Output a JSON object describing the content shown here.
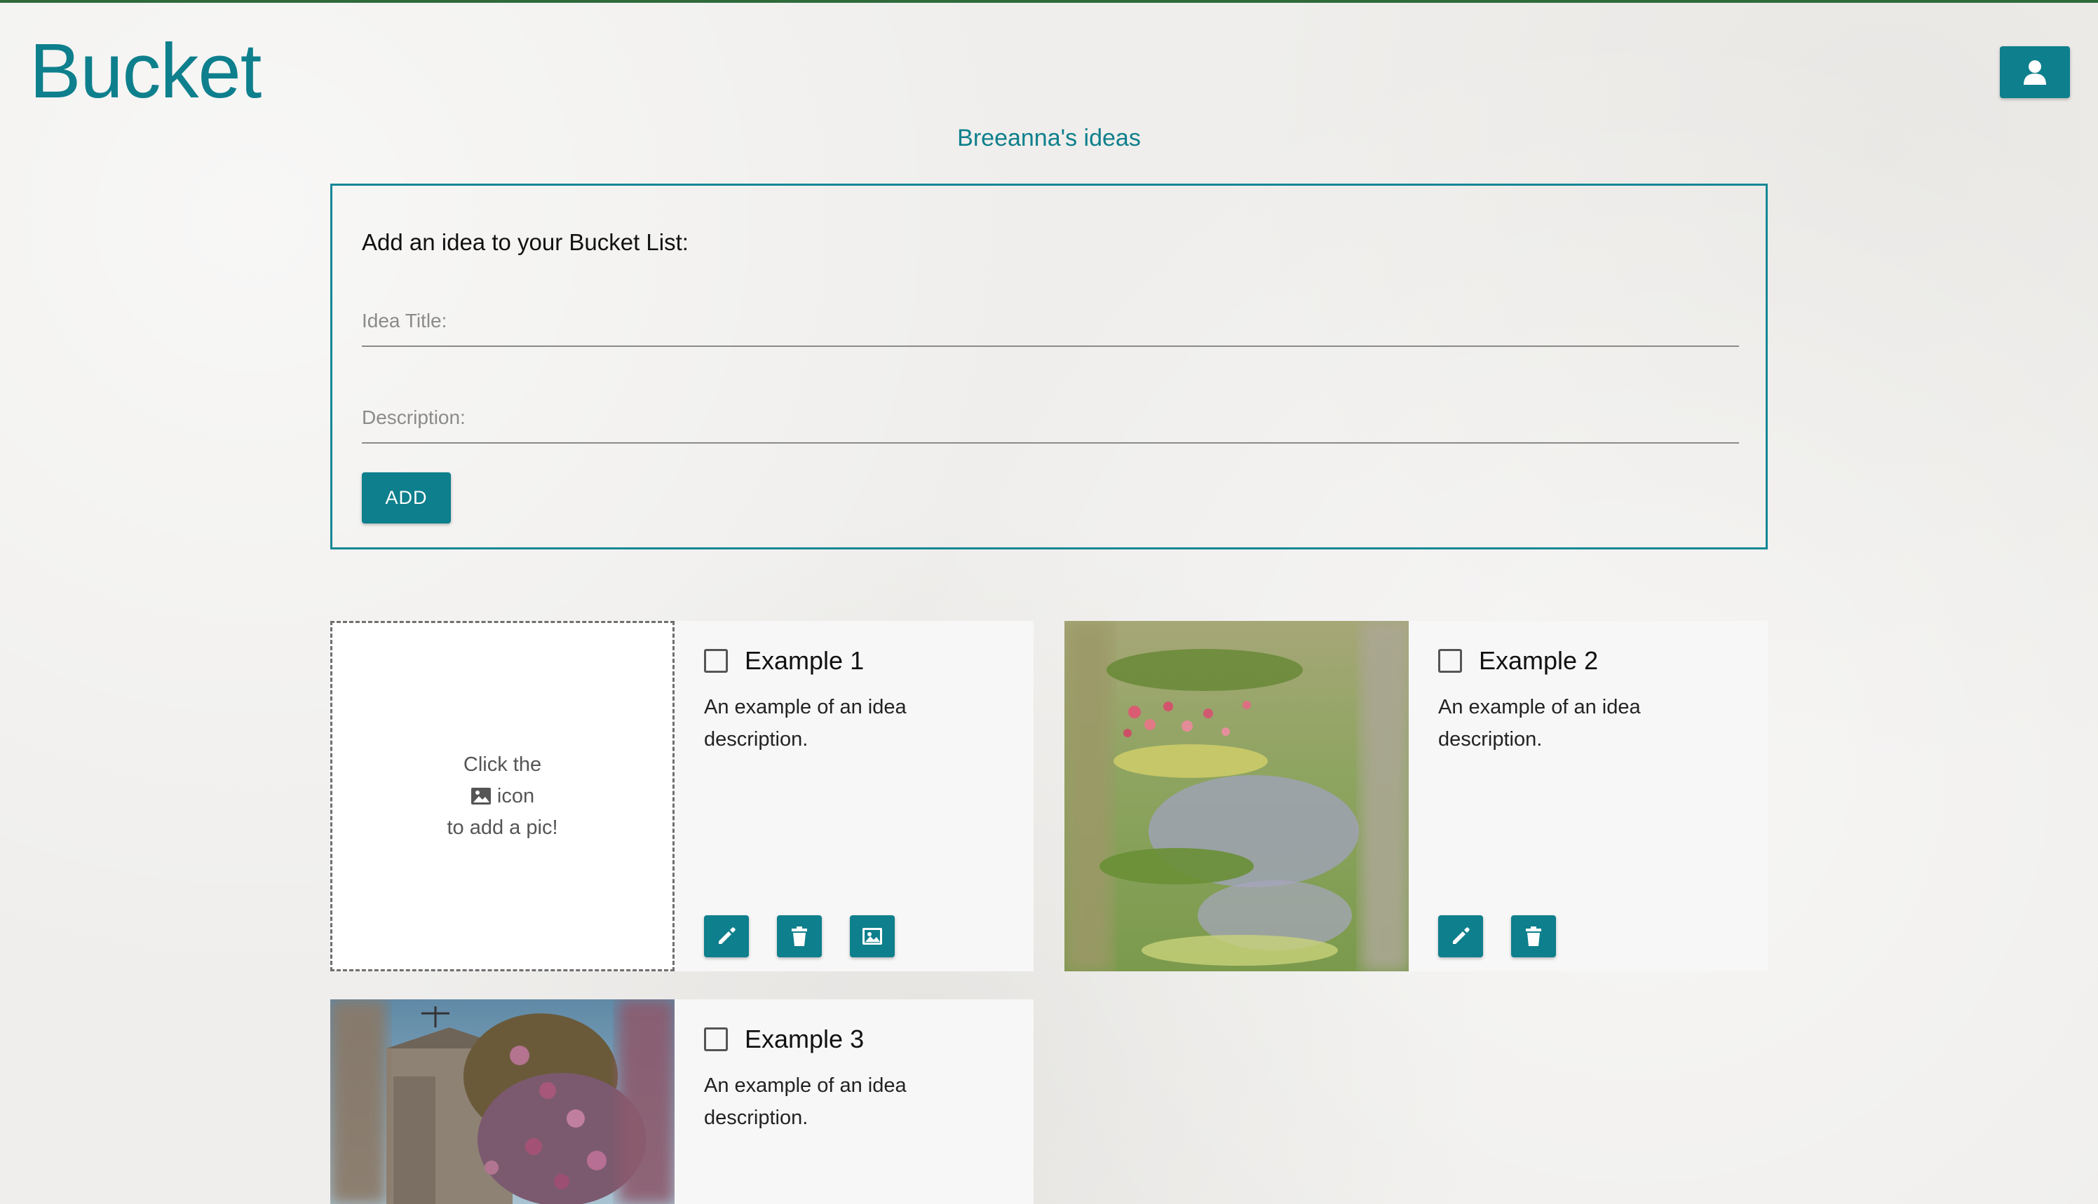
{
  "app": {
    "brand": "Bucket",
    "account_icon": "person-icon"
  },
  "page": {
    "subtitle": "Breeanna's ideas"
  },
  "form": {
    "heading": "Add an idea to your Bucket List:",
    "title_placeholder": "Idea Title:",
    "title_value": "",
    "description_placeholder": "Description:",
    "description_value": "",
    "add_label": "ADD"
  },
  "ideas": [
    {
      "title": "Example 1",
      "description": "An example of an idea description.",
      "checked": false,
      "has_image": false,
      "placeholder": {
        "line1": "Click the",
        "icon": "image-icon",
        "line2": "icon",
        "line3": "to add a pic!"
      },
      "actions": [
        "edit-icon",
        "trash-icon",
        "image-icon"
      ]
    },
    {
      "title": "Example 2",
      "description": "An example of an idea description.",
      "checked": false,
      "has_image": true,
      "image_subject": "water lilies painting",
      "actions": [
        "edit-icon",
        "trash-icon"
      ]
    },
    {
      "title": "Example 3",
      "description": "An example of an idea description.",
      "checked": false,
      "has_image": true,
      "image_subject": "stone building with purple flowering vines",
      "actions": []
    }
  ],
  "colors": {
    "accent": "#0e7f8c",
    "top_rule": "#2f6b3a",
    "background": "#efeeec",
    "card": "#f7f7f7"
  }
}
